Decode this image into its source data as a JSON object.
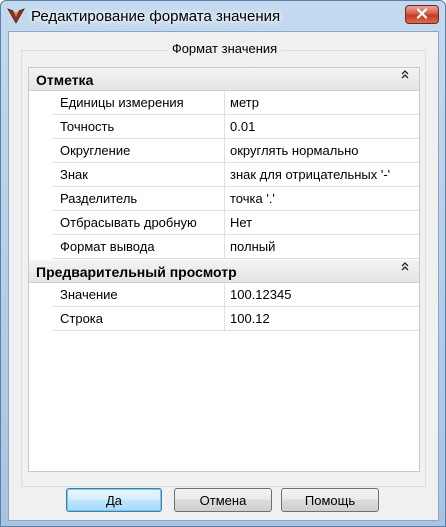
{
  "window": {
    "title": "Редактирование формата значения"
  },
  "group": {
    "title": "Формат значения"
  },
  "sections": [
    {
      "title": "Отметка",
      "rows": [
        {
          "name": "Единицы измерения",
          "value": "метр"
        },
        {
          "name": "Точность",
          "value": "0.01"
        },
        {
          "name": "Округление",
          "value": "округлять нормально"
        },
        {
          "name": "Знак",
          "value": "знак для отрицательных '-'"
        },
        {
          "name": "Разделитель",
          "value": "точка '.'"
        },
        {
          "name": "Отбрасывать дробную",
          "value": "Нет"
        },
        {
          "name": "Формат вывода",
          "value": "полный"
        }
      ]
    },
    {
      "title": "Предварительный просмотр",
      "rows": [
        {
          "name": "Значение",
          "value": "100.12345"
        },
        {
          "name": "Строка",
          "value": "100.12"
        }
      ]
    }
  ],
  "buttons": {
    "ok": "Да",
    "cancel": "Отмена",
    "help": "Помощь"
  },
  "colors": {
    "title_bar": "#b9d1ea",
    "close_button": "#c7432a",
    "default_button": "#bee6fd"
  },
  "icons": {
    "app": "app-logo-icon",
    "close": "close-icon",
    "collapse": "double-chevron-up-icon"
  }
}
